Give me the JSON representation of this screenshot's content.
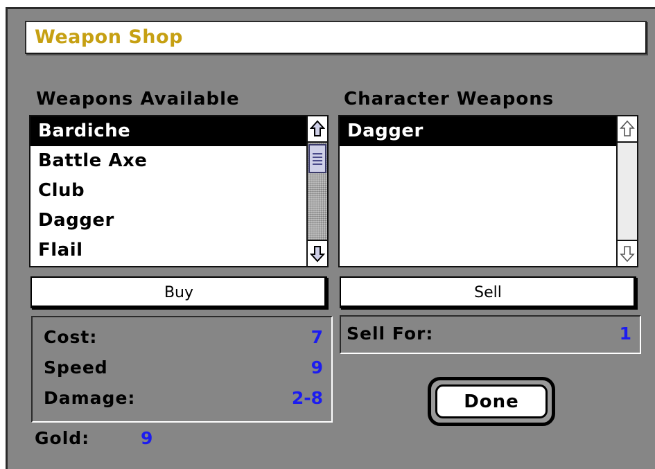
{
  "window": {
    "title": "Weapon Shop"
  },
  "available": {
    "label": "Weapons Available",
    "items": [
      "Bardiche",
      "Battle Axe",
      "Club",
      "Dagger",
      "Flail"
    ],
    "selected_index": 0
  },
  "character": {
    "label": "Character Weapons",
    "items": [
      "Dagger"
    ],
    "selected_index": 0
  },
  "buttons": {
    "buy": "Buy",
    "sell": "Sell",
    "done": "Done"
  },
  "stats": {
    "cost_label": "Cost:",
    "cost_value": "7",
    "speed_label": "Speed",
    "speed_value": "9",
    "damage_label": "Damage:",
    "damage_value": "2-8"
  },
  "sell_for": {
    "label": "Sell For:",
    "value": "1"
  },
  "gold": {
    "label": "Gold:",
    "value": "9"
  },
  "icons": {
    "scroll_up": "arrow-up-icon",
    "scroll_down": "arrow-down-icon"
  },
  "colors": {
    "title_text": "#c6a013",
    "value_text": "#1c1cf0",
    "window_bg": "#868686"
  }
}
